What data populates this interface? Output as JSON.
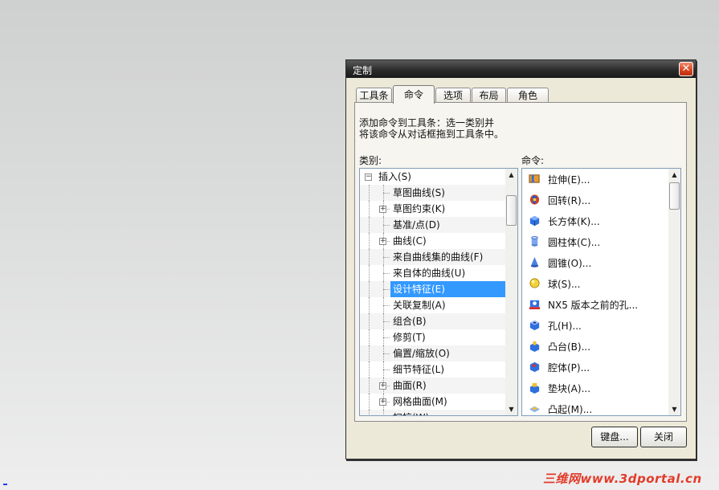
{
  "dialog": {
    "title": "定制",
    "close_glyph": "✕",
    "tabs": [
      "工具条",
      "命令",
      "选项",
      "布局",
      "角色"
    ],
    "active_tab": "命令",
    "instructions": [
      "添加命令到工具条：选一类别并",
      "将该命令从对话框拖到工具条中。"
    ],
    "categories_label": "类别:",
    "commands_label": "命令:",
    "categories": [
      {
        "label": "插入(S)",
        "expander": "−",
        "level": 0
      },
      {
        "label": "草图曲线(S)",
        "expander": "",
        "level": 1
      },
      {
        "label": "草图约束(K)",
        "expander": "+",
        "level": 1
      },
      {
        "label": "基准/点(D)",
        "expander": "",
        "level": 1
      },
      {
        "label": "曲线(C)",
        "expander": "+",
        "level": 1
      },
      {
        "label": "来自曲线集的曲线(F)",
        "expander": "",
        "level": 1
      },
      {
        "label": "来自体的曲线(U)",
        "expander": "",
        "level": 1
      },
      {
        "label": "设计特征(E)",
        "expander": "",
        "level": 1,
        "selected": true
      },
      {
        "label": "关联复制(A)",
        "expander": "",
        "level": 1
      },
      {
        "label": "组合(B)",
        "expander": "",
        "level": 1
      },
      {
        "label": "修剪(T)",
        "expander": "",
        "level": 1
      },
      {
        "label": "偏置/缩放(O)",
        "expander": "",
        "level": 1
      },
      {
        "label": "细节特征(L)",
        "expander": "",
        "level": 1
      },
      {
        "label": "曲面(R)",
        "expander": "+",
        "level": 1
      },
      {
        "label": "网格曲面(M)",
        "expander": "+",
        "level": 1
      },
      {
        "label": "扫掠(W)",
        "expander": "",
        "level": 1
      }
    ],
    "commands": [
      {
        "label": "拉伸(E)...",
        "icon": "extrude-icon"
      },
      {
        "label": "回转(R)...",
        "icon": "revolve-icon"
      },
      {
        "label": "长方体(K)...",
        "icon": "block-icon"
      },
      {
        "label": "圆柱体(C)...",
        "icon": "cylinder-icon"
      },
      {
        "label": "圆锥(O)...",
        "icon": "cone-icon"
      },
      {
        "label": "球(S)...",
        "icon": "sphere-icon"
      },
      {
        "label": "NX5 版本之前的孔...",
        "icon": "legacy-hole-icon"
      },
      {
        "label": "孔(H)...",
        "icon": "hole-icon"
      },
      {
        "label": "凸台(B)...",
        "icon": "boss-icon"
      },
      {
        "label": "腔体(P)...",
        "icon": "pocket-icon"
      },
      {
        "label": "垫块(A)...",
        "icon": "pad-icon"
      },
      {
        "label": "凸起(M)...",
        "icon": "emboss-icon"
      }
    ],
    "buttons": {
      "keyboard": "键盘...",
      "close": "关闭"
    }
  },
  "watermark": "三维网www.3dportal.cn",
  "colors": {
    "selection": "#3399ff",
    "titlebar": "#2c2c2c",
    "close_button": "#d9441f",
    "watermark": "#e23b2a"
  }
}
